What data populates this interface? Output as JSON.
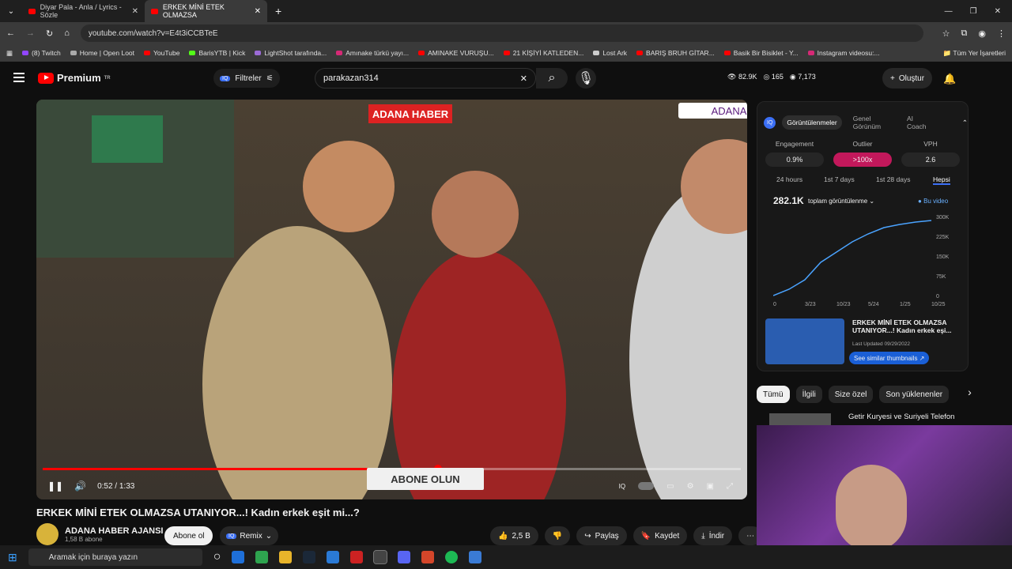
{
  "tabs": [
    {
      "title": "Diyar Pala - Anla / Lyrics - Sözle"
    },
    {
      "title": "ERKEK MİNİ ETEK OLMAZSA"
    }
  ],
  "window": {
    "minimize": "—",
    "restore": "❐",
    "close": "✕"
  },
  "url": "youtube.com/watch?v=E4t3iCCBTeE",
  "bookmarks": [
    "(8) Twitch",
    "Home | Open Loot",
    "YouTube",
    "BarisYTB | Kick",
    "LightShot tarafında...",
    "Amınake türkü yayı...",
    "AMINAKE VURUŞU...",
    "21 KİŞİYİ KATLEDEN...",
    "Lost Ark",
    "BARIŞ BRUH GİTAR...",
    "Basik Bir Bisiklet - Y...",
    "Instagram videosu:...",
    "Tüm Yer İşaretleri"
  ],
  "yt": {
    "logo": "Premium",
    "logo_sup": "TR",
    "filters": "Filtreler",
    "search": "parakazan314",
    "stats": {
      "views": "82.9K",
      "likes": "165",
      "watchers": "7,173"
    },
    "create": "Oluştur"
  },
  "video": {
    "badge": "ADANA",
    "logo": "ADANA HABER",
    "overlay": "ABONE OLUN",
    "time": "0:52 / 1:33",
    "progress": 0.566
  },
  "meta": {
    "title": "ERKEK MİNİ ETEK OLMAZSA UTANIYOR...! Kadın erkek eşit mi...?",
    "channel": "ADANA HABER AJANSI",
    "subs": "1,58 B abone",
    "subscribe": "Abone ol",
    "remix": "Remix",
    "likes": "2,5 B",
    "share": "Paylaş",
    "save": "Kaydet",
    "download": "İndir"
  },
  "panel": {
    "tabs": [
      "Görüntülenmeler",
      "Genel Görünüm",
      "AI Coach"
    ],
    "metrics": [
      {
        "label": "Engagement",
        "value": "0.9%"
      },
      {
        "label": "Outlier",
        "value": ">100x"
      },
      {
        "label": "VPH",
        "value": "2.6"
      }
    ],
    "ranges": [
      "24 hours",
      "1st 7 days",
      "1st 28 days",
      "Hepsi"
    ],
    "total": "282.1K",
    "metric_select": "toplam görüntülenme",
    "this_video": "Bu video",
    "yticks": [
      "300K",
      "225K",
      "150K",
      "75K",
      "0"
    ],
    "xticks": [
      "0",
      "3/23",
      "10/23",
      "5/24",
      "1/25",
      "10/25"
    ],
    "thumb_title": "ERKEK MİNİ ETEK OLMAZSA UTANIYOR...! Kadın erkek eşi...",
    "updated": "Last Updated 09/29/2022",
    "similar": "See similar thumbnails"
  },
  "chips": [
    "Tümü",
    "İlgili",
    "Size özel",
    "Son yüklenenler"
  ],
  "next_video": "Getir Kuryesi ve Suriyeli Telefon",
  "taskbar": {
    "search": "Aramak için buraya yazın"
  }
}
